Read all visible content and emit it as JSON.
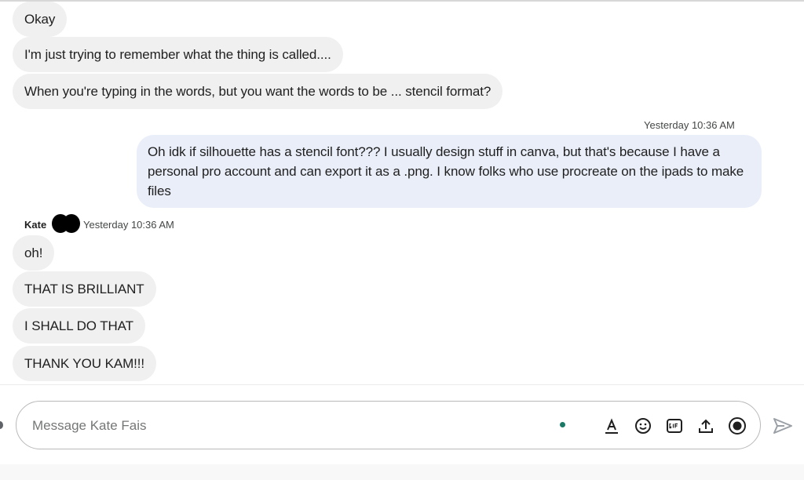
{
  "conversation": {
    "incoming_group_1": [
      "Okay",
      "I'm just trying to remember what the thing is called....",
      "When you're typing in the words, but you want the words to be ... stencil format?"
    ],
    "outgoing": {
      "timestamp": "Yesterday 10:36 AM",
      "text": "Oh idk if silhouette has a stencil font??? I usually design stuff in canva, but that's because I have a personal pro account and can export it as a .png. I know folks who use procreate on the ipads to make files"
    },
    "incoming_group_2": {
      "sender": "Kate",
      "timestamp": "Yesterday 10:36 AM",
      "messages": [
        "oh!",
        "THAT IS BRILLIANT",
        "I SHALL DO THAT",
        "THANK YOU KAM!!!"
      ]
    }
  },
  "composer": {
    "placeholder": "Message Kate Fais",
    "value": ""
  },
  "icons": {
    "text_format": "text-format-icon",
    "emoji": "emoji-icon",
    "gif": "gif-icon",
    "upload": "upload-icon",
    "record": "record-icon",
    "send": "send-icon",
    "status_dot": "status-dot"
  },
  "colors": {
    "incoming_bubble": "#f0f0f0",
    "outgoing_bubble": "#e9eef9",
    "status_dot": "#1b7a66"
  }
}
